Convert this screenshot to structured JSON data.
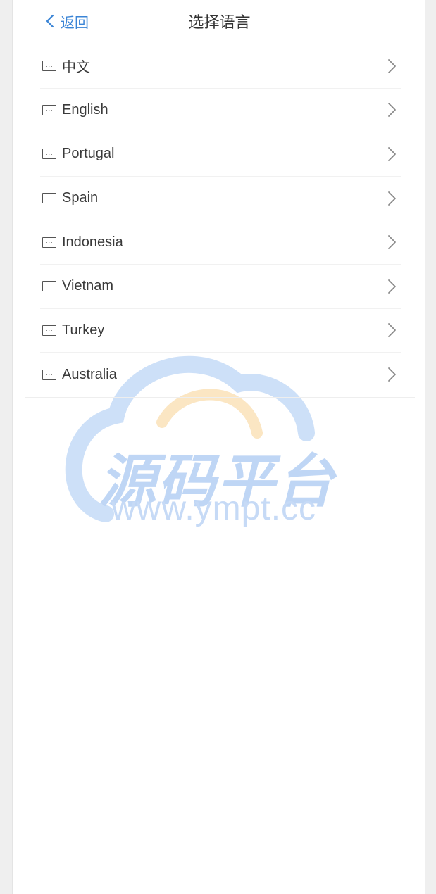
{
  "header": {
    "back_label": "返回",
    "title": "选择语言"
  },
  "languages": [
    {
      "label": "中文"
    },
    {
      "label": "English"
    },
    {
      "label": "Portugal"
    },
    {
      "label": "Spain"
    },
    {
      "label": "Indonesia"
    },
    {
      "label": "Vietnam"
    },
    {
      "label": "Turkey"
    },
    {
      "label": "Australia"
    }
  ],
  "watermark": {
    "title": "源码平台",
    "url": "www.ympt.cc"
  },
  "colors": {
    "accent": "#3a84d6",
    "text": "#333333",
    "watermark_blue": "#b9d2f4",
    "watermark_orange": "#fbe3bd"
  },
  "icons": {
    "back": "chevron-left-icon",
    "item_flag": "flag-icon",
    "item_arrow": "chevron-right-icon"
  }
}
